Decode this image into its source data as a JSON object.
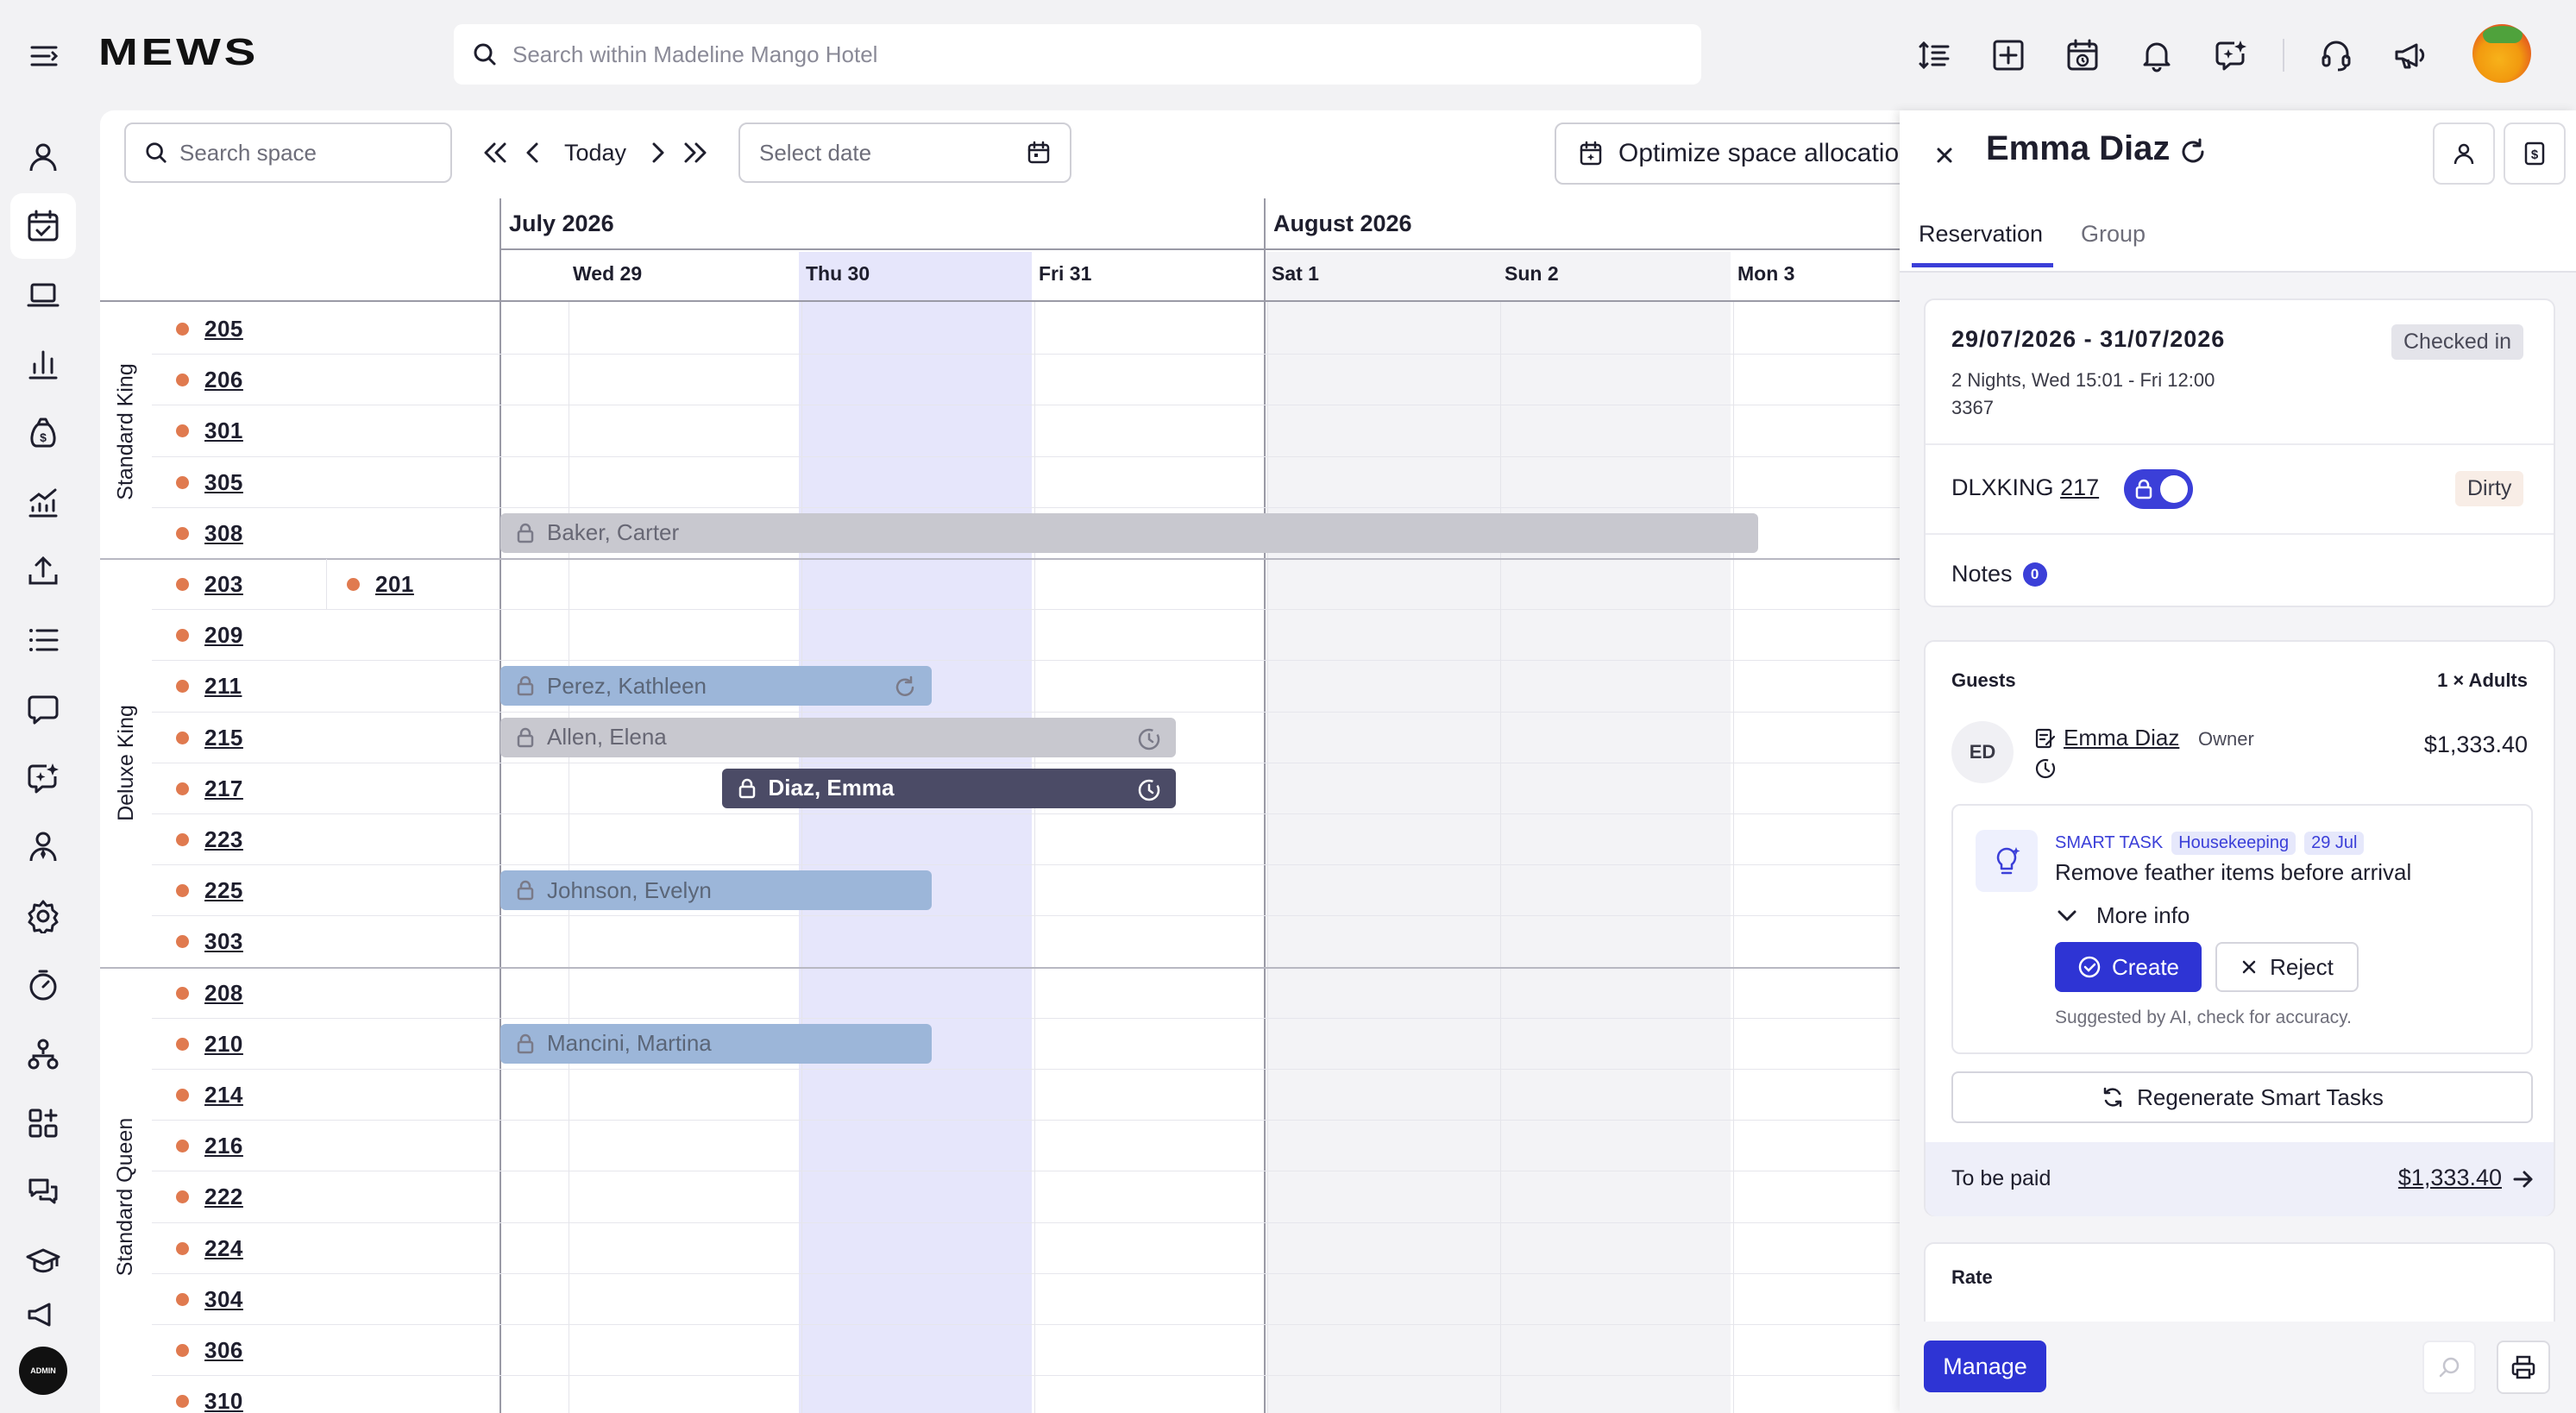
{
  "app": {
    "logo": "MEWS",
    "global_search_placeholder": "Search within Madeline Mango Hotel",
    "admin_label": "ADMIN"
  },
  "topbar_icons": [
    "line-spacing-icon",
    "add-square-icon",
    "calendar-clock-icon",
    "bell-icon",
    "ai-chat-icon",
    "headset-icon",
    "megaphone-icon"
  ],
  "sidebar_icons": [
    "person-icon",
    "calendar-check-icon",
    "laptop-icon",
    "bar-chart-icon",
    "money-bag-icon",
    "trend-chart-icon",
    "upload-icon",
    "list-icon",
    "message-icon",
    "ai-message-icon",
    "user-tie-icon",
    "gear-icon",
    "timer-icon",
    "hierarchy-icon",
    "apps-add-icon",
    "chat-bubbles-icon",
    "graduation-cap-icon",
    "megaphone-icon"
  ],
  "toolbar": {
    "search_space_placeholder": "Search space",
    "today_label": "Today",
    "select_date_placeholder": "Select date",
    "optimize_label": "Optimize space allocation"
  },
  "timeline": {
    "months": [
      {
        "label": "July 2026"
      },
      {
        "label": "August 2026"
      }
    ],
    "days": [
      "Wed 29",
      "Thu 30",
      "Fri 31",
      "Sat 1",
      "Sun 2",
      "Mon 3"
    ],
    "highlight_day": "Thu 30",
    "groups": [
      {
        "name": "Standard King",
        "rooms": [
          "205",
          "206",
          "301",
          "305",
          "308"
        ]
      },
      {
        "name": "Deluxe King",
        "rooms": [
          "203",
          "209",
          "211",
          "215",
          "217",
          "223",
          "225",
          "303"
        ],
        "extra_room": "201"
      },
      {
        "name": "Standard Queen",
        "rooms": [
          "208",
          "210",
          "214",
          "216",
          "222",
          "224",
          "304",
          "306",
          "310"
        ]
      }
    ],
    "reservations": [
      {
        "name": "Baker, Carter",
        "room": "308",
        "style": "gray"
      },
      {
        "name": "Perez, Kathleen",
        "room": "211",
        "style": "blue",
        "end_icon": "refresh-icon"
      },
      {
        "name": "Allen, Elena",
        "room": "215",
        "style": "gray",
        "end_icon": "history-icon"
      },
      {
        "name": "Diaz, Emma",
        "room": "217",
        "style": "dark",
        "end_icon": "history-icon"
      },
      {
        "name": "Johnson, Evelyn",
        "room": "225",
        "style": "blue"
      },
      {
        "name": "Mancini, Martina",
        "room": "210",
        "style": "blue"
      }
    ]
  },
  "panel": {
    "guest_name": "Emma Diaz",
    "tabs": [
      "Reservation",
      "Group"
    ],
    "reservation": {
      "dates": "29/07/2026 - 31/07/2026",
      "status": "Checked in",
      "nights_info": "2 Nights, Wed 15:01 - Fri 12:00",
      "number": "3367",
      "room_type": "DLXKING",
      "room_number": "217",
      "room_state": "Dirty",
      "notes_label": "Notes",
      "notes_count": "0"
    },
    "guests": {
      "label": "Guests",
      "count": "1 × Adults",
      "initials": "ED",
      "name": "Emma Diaz",
      "role": "Owner",
      "price": "$1,333.40"
    },
    "smart_task": {
      "label": "SMART TASK",
      "category": "Housekeeping",
      "date": "29 Jul",
      "title": "Remove feather items before arrival",
      "more_info": "More info",
      "create": "Create",
      "reject": "Reject",
      "hint": "Suggested by AI, check for accuracy."
    },
    "regenerate_label": "Regenerate Smart Tasks",
    "to_be_paid_label": "To be paid",
    "to_be_paid_amount": "$1,333.40",
    "rate_label": "Rate",
    "manage_label": "Manage"
  },
  "colors": {
    "accent": "#2e34d4",
    "room_dot": "#e07a4f",
    "highlight_column": "#e6e6fb",
    "weekend_column": "#f3f3f6"
  }
}
